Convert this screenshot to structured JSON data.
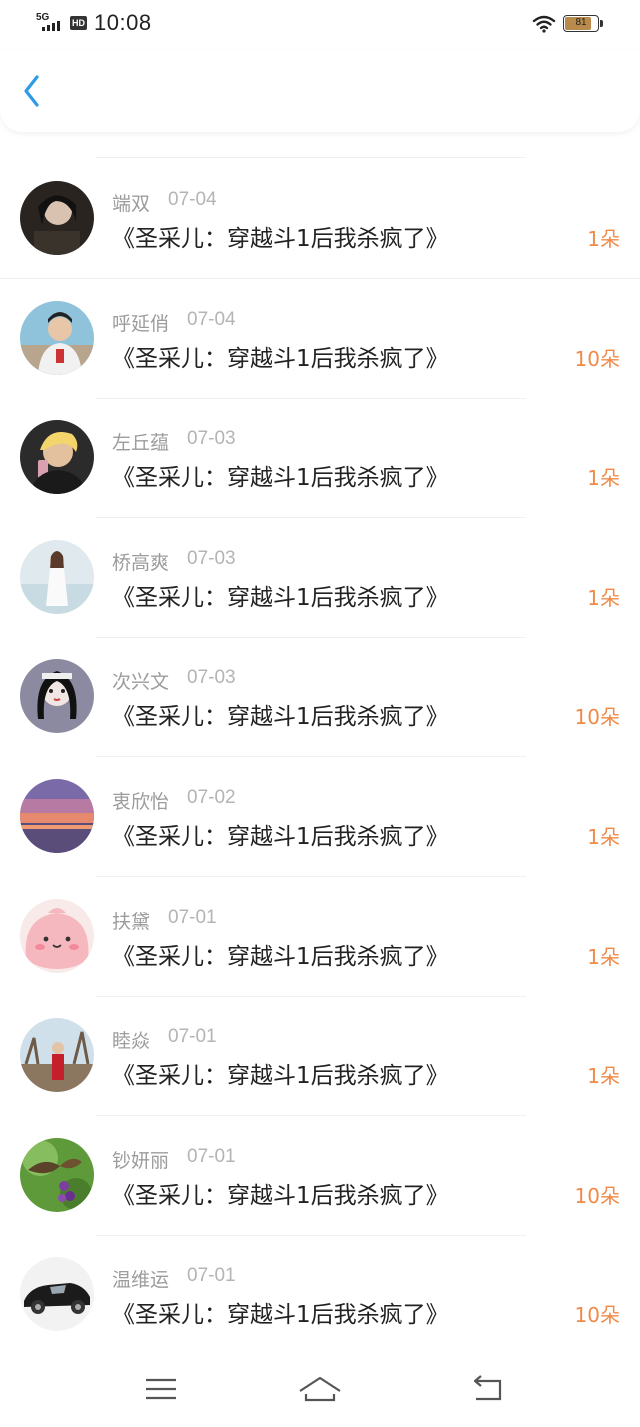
{
  "status_bar": {
    "network": "5G",
    "hd": "HD",
    "time": "10:08",
    "battery": "81"
  },
  "nav": {
    "back_icon": "chevron-left-icon",
    "accent_color": "#2e9be8"
  },
  "colors": {
    "amount": "#f08a48",
    "name": "#9c9c9c",
    "title": "#222222"
  },
  "records": [
    {
      "name": "端双",
      "date": "07-04",
      "book": "《圣采儿：穿越斗1后我杀疯了》",
      "amount": "1朵"
    },
    {
      "name": "呼延俏",
      "date": "07-04",
      "book": "《圣采儿：穿越斗1后我杀疯了》",
      "amount": "10朵"
    },
    {
      "name": "左丘蕴",
      "date": "07-03",
      "book": "《圣采儿：穿越斗1后我杀疯了》",
      "amount": "1朵"
    },
    {
      "name": "桥高爽",
      "date": "07-03",
      "book": "《圣采儿：穿越斗1后我杀疯了》",
      "amount": "1朵"
    },
    {
      "name": "次兴文",
      "date": "07-03",
      "book": "《圣采儿：穿越斗1后我杀疯了》",
      "amount": "10朵"
    },
    {
      "name": "衷欣怡",
      "date": "07-02",
      "book": "《圣采儿：穿越斗1后我杀疯了》",
      "amount": "1朵"
    },
    {
      "name": "扶黛",
      "date": "07-01",
      "book": "《圣采儿：穿越斗1后我杀疯了》",
      "amount": "1朵"
    },
    {
      "name": "睦焱",
      "date": "07-01",
      "book": "《圣采儿：穿越斗1后我杀疯了》",
      "amount": "1朵"
    },
    {
      "name": "钞妍丽",
      "date": "07-01",
      "book": "《圣采儿：穿越斗1后我杀疯了》",
      "amount": "10朵"
    },
    {
      "name": "温维运",
      "date": "07-01",
      "book": "《圣采儿：穿越斗1后我杀疯了》",
      "amount": "10朵"
    }
  ],
  "system_nav": {
    "menu_icon": "menu-icon",
    "home_icon": "home-icon",
    "back_icon": "return-icon"
  }
}
